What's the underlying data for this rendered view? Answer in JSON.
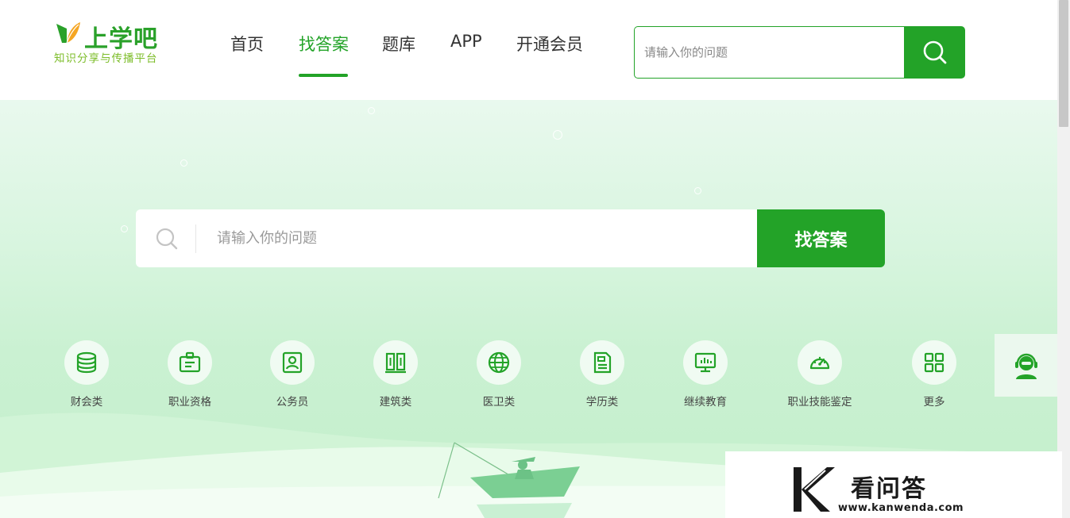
{
  "brand": {
    "name": "上学吧",
    "slogan": "知识分享与传播平台",
    "primary_color": "#23a328"
  },
  "nav": {
    "items": [
      {
        "label": "首页",
        "active": false
      },
      {
        "label": "找答案",
        "active": true
      },
      {
        "label": "题库",
        "active": false
      },
      {
        "label": "APP",
        "active": false
      },
      {
        "label": "开通会员",
        "active": false
      }
    ]
  },
  "top_search": {
    "placeholder": "请输入你的问题",
    "icon": "search-icon"
  },
  "main_search": {
    "placeholder": "请输入你的问题",
    "button_label": "找答案",
    "icon": "search-icon"
  },
  "categories": [
    {
      "label": "财会类",
      "icon": "database-icon"
    },
    {
      "label": "职业资格",
      "icon": "id-badge-icon"
    },
    {
      "label": "公务员",
      "icon": "portrait-icon"
    },
    {
      "label": "建筑类",
      "icon": "building-icon"
    },
    {
      "label": "医卫类",
      "icon": "globe-icon"
    },
    {
      "label": "学历类",
      "icon": "document-icon"
    },
    {
      "label": "继续教育",
      "icon": "monitor-chart-icon"
    },
    {
      "label": "职业技能鉴定",
      "icon": "gauge-icon"
    },
    {
      "label": "更多",
      "icon": "grid-icon"
    }
  ],
  "service": {
    "icon": "customer-service-icon"
  },
  "watermark": {
    "title": "看问答",
    "url": "www.kanwenda.com"
  }
}
